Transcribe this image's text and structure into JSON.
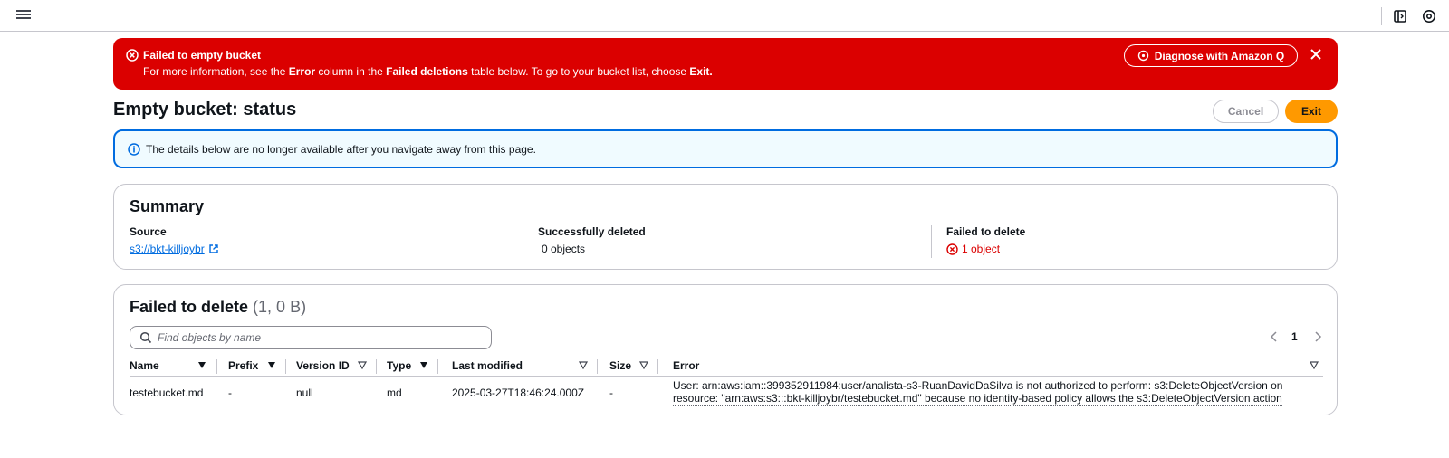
{
  "topbar": {
    "menu_icon": "hamburger-icon",
    "icons": [
      "panel-icon",
      "settings-icon"
    ]
  },
  "alert": {
    "title": "Failed to empty bucket",
    "msg_part1": "For more information, see the ",
    "msg_bold1": "Error",
    "msg_part2": " column in the ",
    "msg_bold2": "Failed deletions",
    "msg_part3": " table below. To go to your bucket list, choose ",
    "msg_bold3": "Exit.",
    "diagnose_label": "Diagnose with Amazon Q",
    "color": "#db0000"
  },
  "page": {
    "title": "Empty bucket: status",
    "cancel_label": "Cancel",
    "exit_label": "Exit",
    "exit_color": "#ff9900"
  },
  "info": {
    "text": "The details below are no longer available after you navigate away from this page."
  },
  "summary": {
    "title": "Summary",
    "source_label": "Source",
    "source_value": "s3://bkt-killjoybr",
    "success_label": "Successfully deleted",
    "success_value": "0 objects",
    "failed_label": "Failed to delete",
    "failed_value": "1 object"
  },
  "failed": {
    "title": "Failed to delete",
    "count": "(1, 0 B)",
    "search_placeholder": "Find objects by name",
    "page_number": "1",
    "columns": [
      "Name",
      "Prefix",
      "Version ID",
      "Type",
      "Last modified",
      "Size",
      "Error"
    ],
    "rows": [
      {
        "name": "testebucket.md",
        "prefix": "-",
        "version_id": "null",
        "type": "md",
        "last_modified": "2025-03-27T18:46:24.000Z",
        "size": "-",
        "error_line1": "User: arn:aws:iam::399352911984:user/analista-s3-RuanDavidDaSilva is not authorized to perform: s3:DeleteObjectVersion on",
        "error_line2": "resource: \"arn:aws:s3:::bkt-killjoybr/testebucket.md\" because no identity-based policy allows the s3:DeleteObjectVersion action"
      }
    ]
  }
}
